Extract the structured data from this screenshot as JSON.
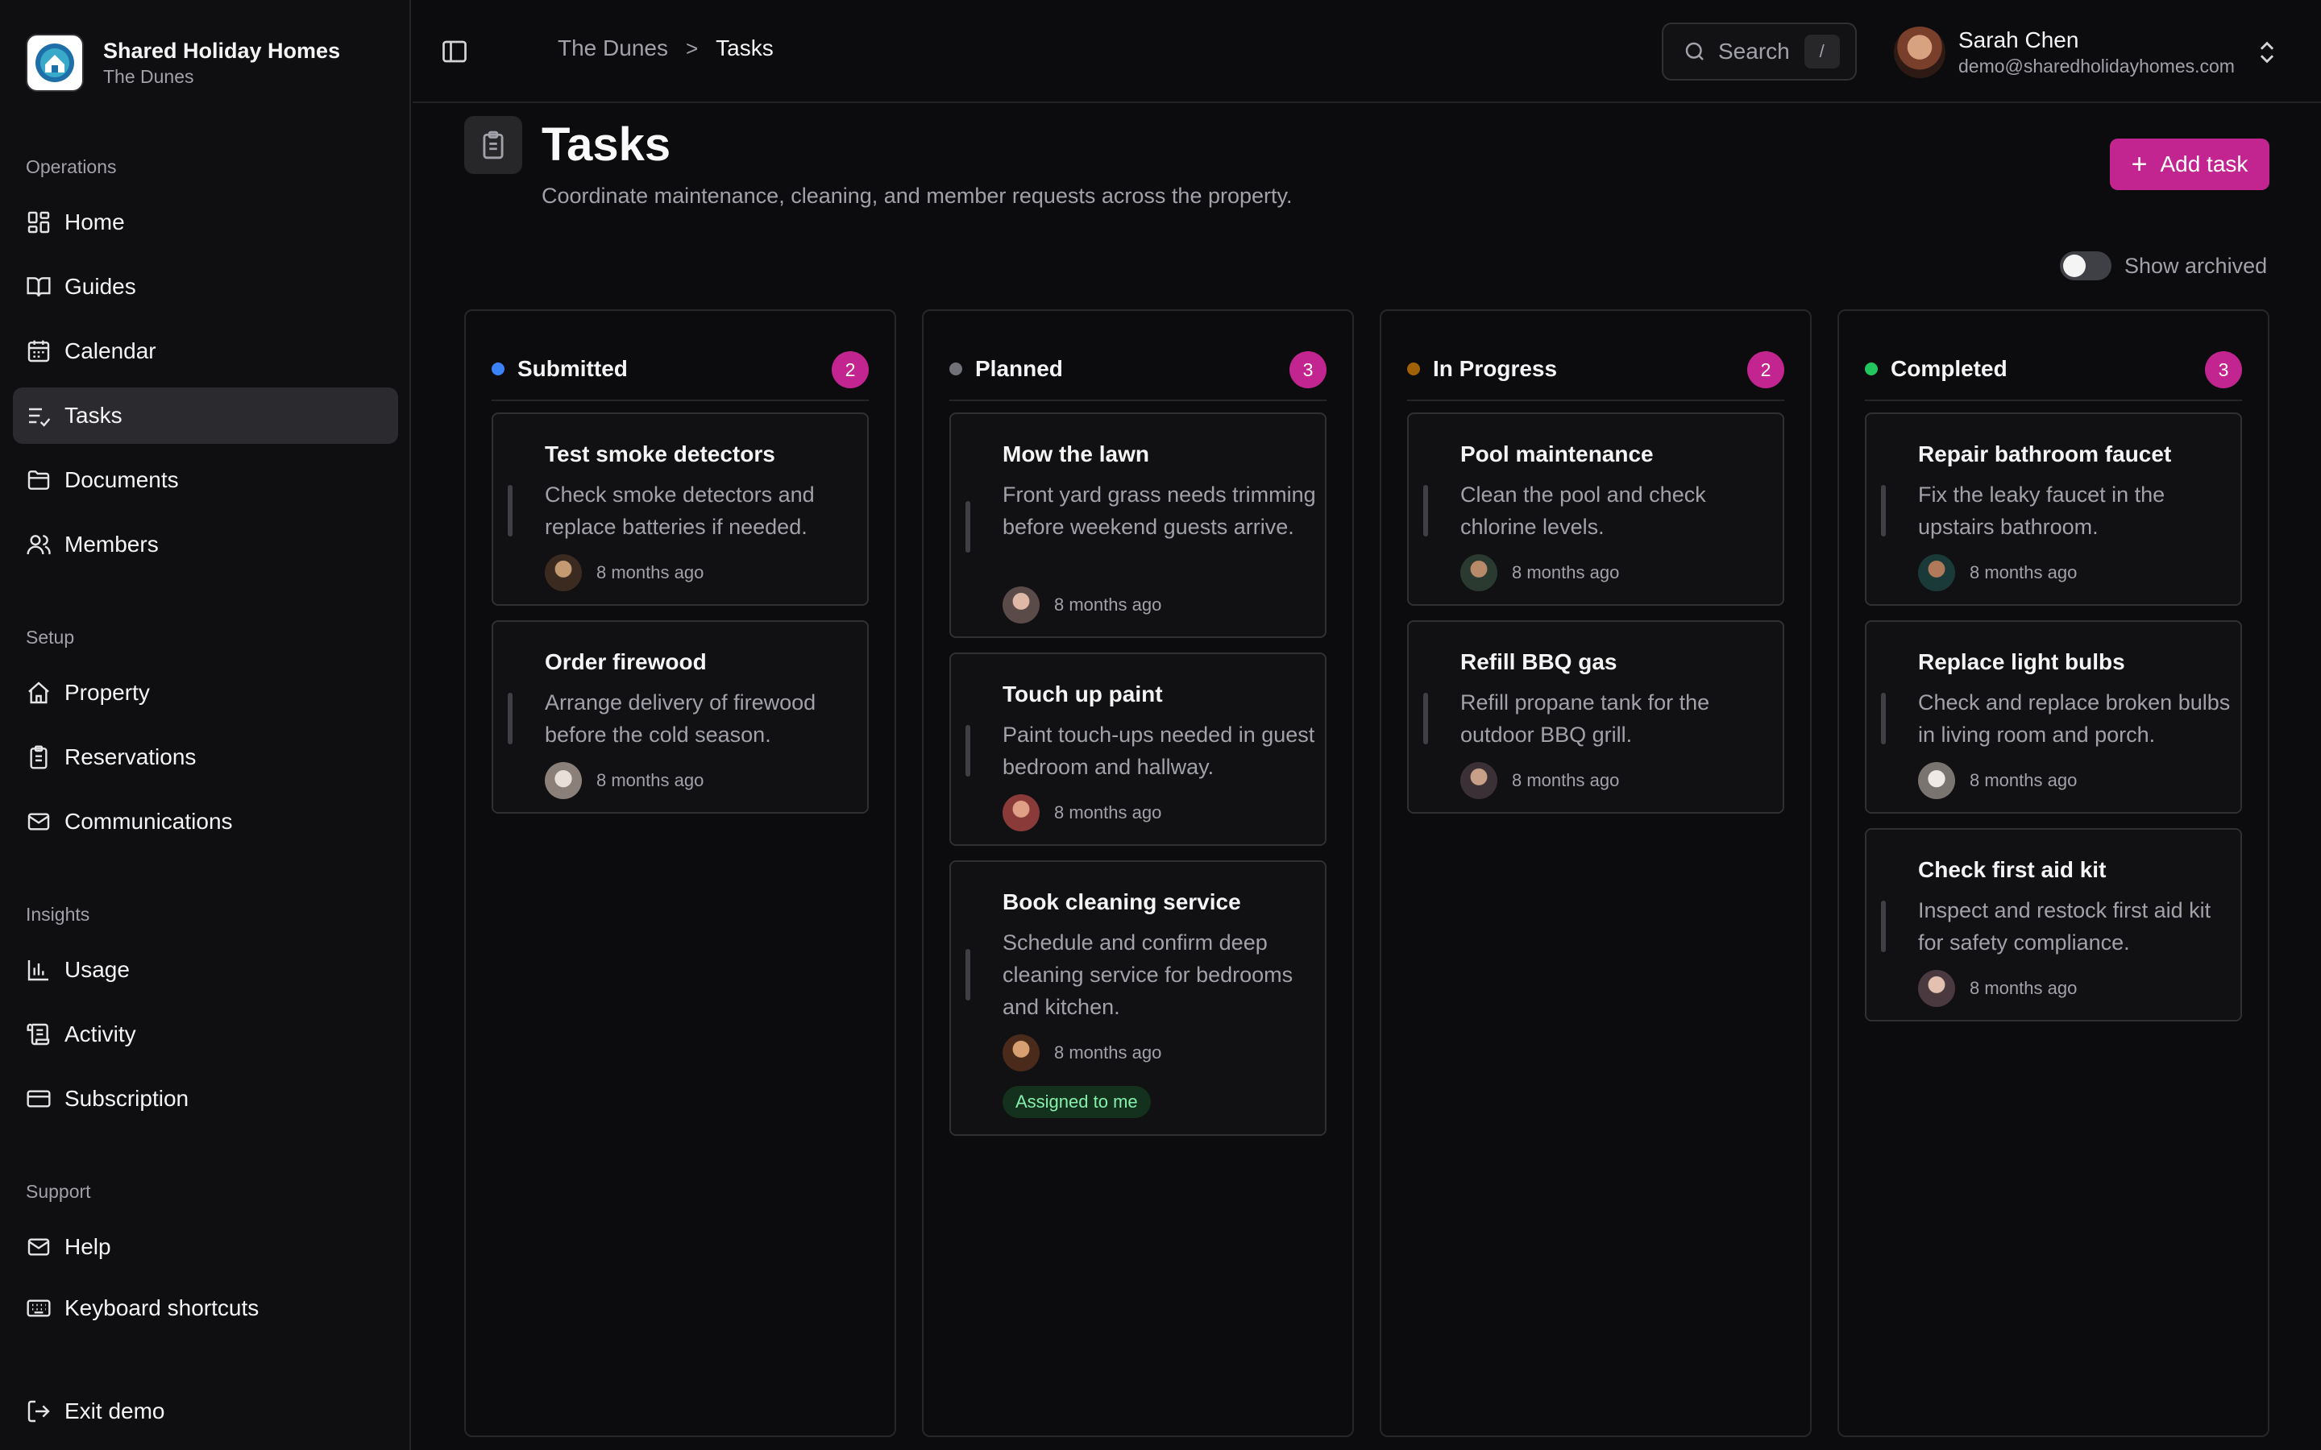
{
  "sidebar": {
    "brand_name": "Shared Holiday Homes",
    "brand_sub": "The Dunes",
    "sections": {
      "operations": "Operations",
      "setup": "Setup",
      "insights": "Insights",
      "support": "Support"
    },
    "items": {
      "home": "Home",
      "guides": "Guides",
      "calendar": "Calendar",
      "tasks": "Tasks",
      "documents": "Documents",
      "members": "Members",
      "property": "Property",
      "reservations": "Reservations",
      "communications": "Communications",
      "usage": "Usage",
      "activity": "Activity",
      "subscription": "Subscription",
      "help": "Help",
      "keyboard_shortcuts": "Keyboard shortcuts",
      "exit_demo": "Exit demo"
    },
    "active_item": "tasks"
  },
  "topbar": {
    "breadcrumb_parent": "The Dunes",
    "breadcrumb_separator": ">",
    "breadcrumb_current": "Tasks",
    "search_placeholder": "Search",
    "search_shortcut": "/",
    "user_name": "Sarah Chen",
    "user_email": "demo@sharedholidayhomes.com"
  },
  "page": {
    "title": "Tasks",
    "subtitle": "Coordinate maintenance, cleaning, and member requests across the property.",
    "add_button": "Add task",
    "show_archived_label": "Show archived",
    "show_archived": false
  },
  "columns": [
    {
      "title": "Submitted",
      "count": "2",
      "dot_color": "#3b82f6",
      "cards": [
        {
          "title": "Test smoke detectors",
          "description": "Check smoke detectors and replace batteries if needed.",
          "time": "8 months ago"
        },
        {
          "title": "Order firewood",
          "description": "Arrange delivery of firewood before the cold season.",
          "time": "8 months ago"
        }
      ]
    },
    {
      "title": "Planned",
      "count": "3",
      "dot_color": "#71717a",
      "cards": [
        {
          "title": "Mow the lawn",
          "description": "Front yard grass needs trimming before weekend guests arrive.",
          "time": "8 months ago"
        },
        {
          "title": "Touch up paint",
          "description": "Paint touch-ups needed in guest bedroom and hallway.",
          "time": "8 months ago"
        },
        {
          "title": "Book cleaning service",
          "description": "Schedule and confirm deep cleaning service for bedrooms and kitchen.",
          "time": "8 months ago",
          "badge": "Assigned to me"
        }
      ]
    },
    {
      "title": "In Progress",
      "count": "2",
      "dot_color": "#a16207",
      "cards": [
        {
          "title": "Pool maintenance",
          "description": "Clean the pool and check chlorine levels.",
          "time": "8 months ago"
        },
        {
          "title": "Refill BBQ gas",
          "description": "Refill propane tank for the outdoor BBQ grill.",
          "time": "8 months ago"
        }
      ]
    },
    {
      "title": "Completed",
      "count": "3",
      "dot_color": "#22c55e",
      "cards": [
        {
          "title": "Repair bathroom faucet",
          "description": "Fix the leaky faucet in the upstairs bathroom.",
          "time": "8 months ago"
        },
        {
          "title": "Replace light bulbs",
          "description": "Check and replace broken bulbs in living room and porch.",
          "time": "8 months ago"
        },
        {
          "title": "Check first aid kit",
          "description": "Inspect and restock first aid kit for safety compliance.",
          "time": "8 months ago"
        }
      ]
    }
  ],
  "colors": {
    "accent": "#c2258f",
    "background": "#0c0c0e",
    "badge_bg": "#14311d",
    "badge_text": "#86efac"
  }
}
